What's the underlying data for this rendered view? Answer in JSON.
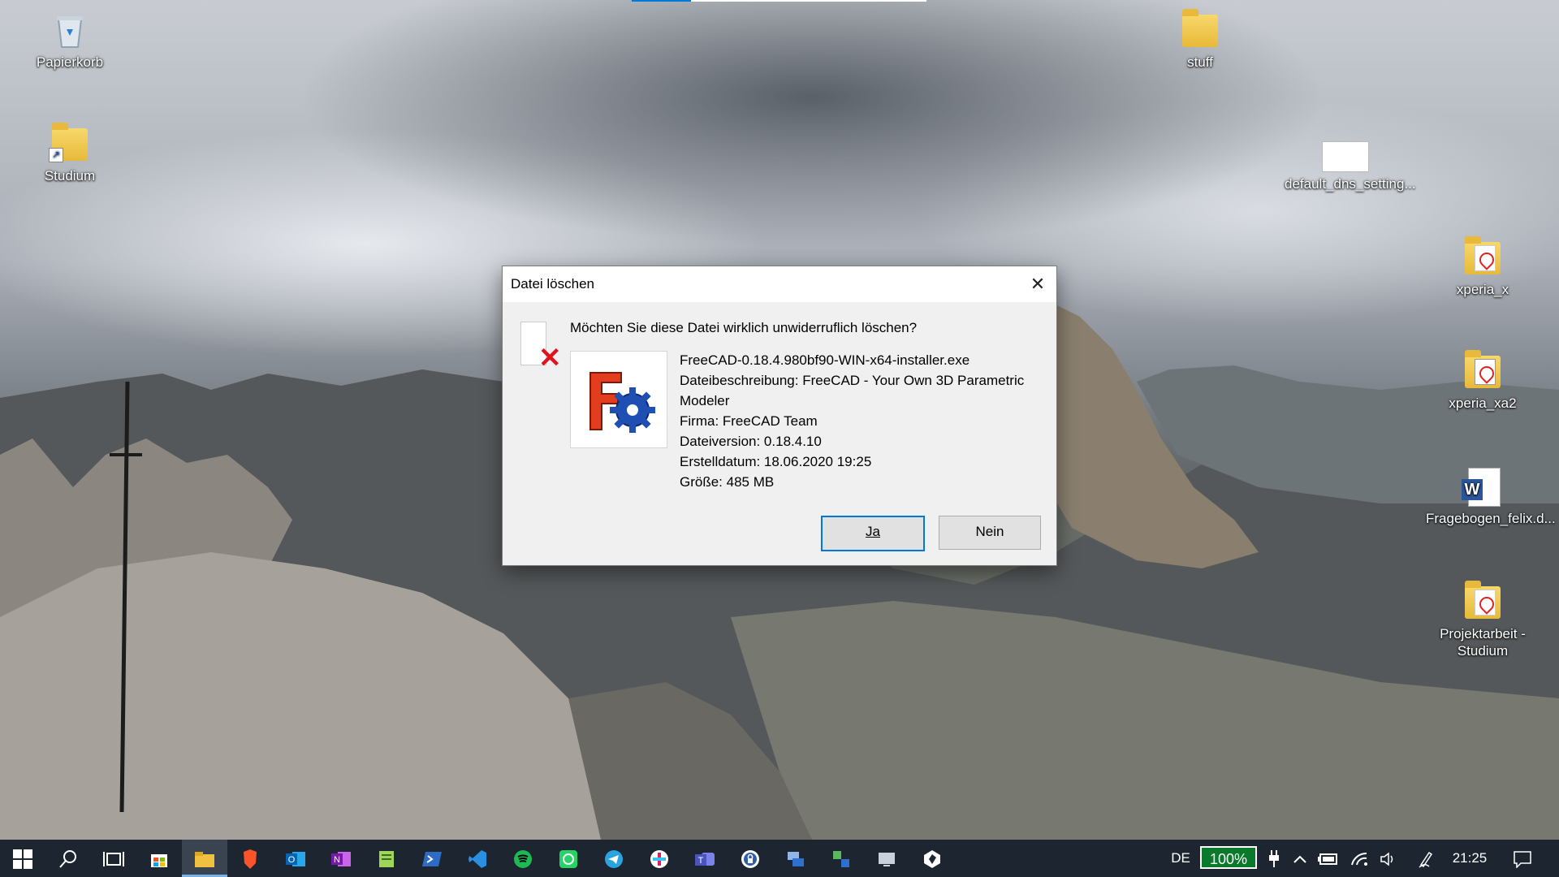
{
  "desktop": {
    "icons": [
      {
        "id": "recycle-bin",
        "label": "Papierkorb"
      },
      {
        "id": "studium",
        "label": "Studium"
      },
      {
        "id": "stuff",
        "label": "stuff"
      },
      {
        "id": "default-dns",
        "label": "default_dns_setting..."
      },
      {
        "id": "xperia-x",
        "label": "xperia_x"
      },
      {
        "id": "xperia-xa2",
        "label": "xperia_xa2"
      },
      {
        "id": "fragebogen",
        "label": "Fragebogen_felix.d..."
      },
      {
        "id": "projektarbeit",
        "label": "Projektarbeit - Studium"
      }
    ]
  },
  "dialog": {
    "title": "Datei löschen",
    "close_glyph": "✕",
    "question": "Möchten Sie diese Datei wirklich unwiderruflich löschen?",
    "file": {
      "name": "FreeCAD-0.18.4.980bf90-WIN-x64-installer.exe",
      "description": "Dateibeschreibung: FreeCAD - Your Own 3D Parametric Modeler",
      "company": "Firma: FreeCAD Team",
      "version": "Dateiversion: 0.18.4.10",
      "created": "Erstelldatum: 18.06.2020 19:25",
      "size": "Größe: 485 MB"
    },
    "buttons": {
      "yes": "Ja",
      "no": "Nein"
    }
  },
  "taskbar": {
    "apps": [
      "start",
      "search",
      "task-view",
      "store",
      "file-explorer",
      "brave",
      "outlook",
      "onenote",
      "notepad-plus",
      "powershell",
      "vscode",
      "spotify",
      "whatsapp",
      "telegram",
      "slack",
      "teams",
      "keepass",
      "remote-desktop",
      "network",
      "monitor",
      "obsidian"
    ],
    "language": "DE",
    "battery": "100%",
    "clock": "21:25"
  },
  "colors": {
    "accent": "#0078d7",
    "taskbar": "#1c2530",
    "battery_fill": "#0a7a2a",
    "delete_x": "#e0141e"
  }
}
